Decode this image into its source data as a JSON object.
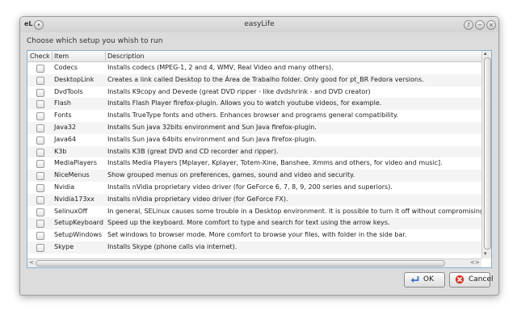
{
  "window": {
    "app_logo": "eL",
    "title": "easyLife",
    "menu_glyph": "•",
    "help_glyph": "?",
    "minimize_glyph": "−",
    "close_glyph": "×"
  },
  "prompt": "Choose which setup you whish to run",
  "table": {
    "columns": [
      "Check",
      "Item",
      "Description"
    ],
    "rows": [
      {
        "item": "Codecs",
        "desc": "Installs codecs (MPEG-1, 2 and 4, WMV, Real Video and many others).",
        "checked": false
      },
      {
        "item": "DesktopLink",
        "desc": "Creates a link called Desktop to the Área de Trabalho folder. Only good for pt_BR Fedora versions.",
        "checked": false
      },
      {
        "item": "DvdTools",
        "desc": "Installs K9copy and Devede (great DVD ripper - like dvdshrink - and DVD creator)",
        "checked": false
      },
      {
        "item": "Flash",
        "desc": "Installs Flash Player firefox-plugin. Allows you to watch youtube videos, for example.",
        "checked": false
      },
      {
        "item": "Fonts",
        "desc": "Installs TrueType fonts and others. Enhances browser and programs general compatibility.",
        "checked": false
      },
      {
        "item": "Java32",
        "desc": "Installs Sun java 32bits environment and Sun Java firefox-plugin.",
        "checked": false
      },
      {
        "item": "Java64",
        "desc": "Installs Sun java 64bits environment and Sun Java firefox-plugin.",
        "checked": false
      },
      {
        "item": "K3b",
        "desc": "Installs K3B (great DVD and CD recorder and ripper).",
        "checked": false
      },
      {
        "item": "MediaPlayers",
        "desc": "Installs Media Players [Mplayer, Kplayer, Totem-Xine, Banshee, Xmms and others, for video and music].",
        "checked": false
      },
      {
        "item": "NiceMenus",
        "desc": "Show grouped menus on preferences, games, sound and video and security.",
        "checked": false
      },
      {
        "item": "Nvidia",
        "desc": "Installs nVidia proprietary video driver (for GeForce 6, 7, 8, 9, 200 series and superiors).",
        "checked": false
      },
      {
        "item": "Nvidia173xx",
        "desc": "Installs nVidia proprietary video driver (for GeForce FX).",
        "checked": false
      },
      {
        "item": "SelinuxOff",
        "desc": "In general, SELinux causes some trouble in a Desktop environment. It is possible to turn it off without compromising",
        "checked": false
      },
      {
        "item": "SetupKeyboard",
        "desc": "Speed up the keyboard. More comfort to type and search for text using the arrow keys.",
        "checked": false
      },
      {
        "item": "SetupWindows",
        "desc": "Set windows to browser mode. More comfort to browse your files, with folder in the side bar.",
        "checked": false
      },
      {
        "item": "Skype",
        "desc": "Installs Skype (phone calls via internet).",
        "checked": false
      }
    ]
  },
  "scroll": {
    "up_glyph": "▴",
    "down_glyph": "▾",
    "left_glyph": "<",
    "right_glyph": "<>"
  },
  "buttons": {
    "ok_label": "OK",
    "cancel_label": "Cancel"
  },
  "icons": {
    "ok": "ok-arrow-icon",
    "cancel": "cancel-x-icon"
  },
  "colors": {
    "cancel_icon": "#d23a2a",
    "ok_icon": "#3a72c4"
  }
}
